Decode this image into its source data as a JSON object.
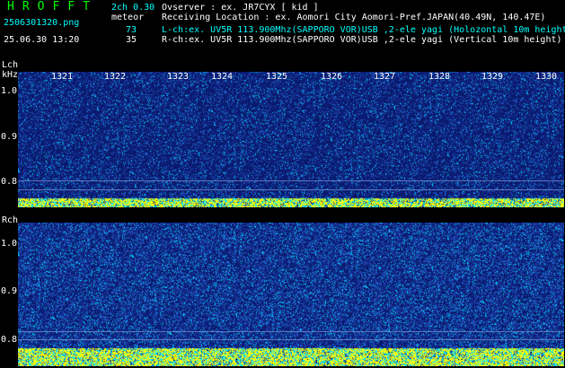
{
  "header": {
    "app_title": "HROFFT",
    "mode": "2ch 0.30",
    "meteor_label": "meteor",
    "filename": "2506301320.png",
    "datetime": "25.06.30 13:20",
    "count_l": "73",
    "count_r": "35",
    "observer": "Ovserver            : ex. JR7CYX [ kid ]",
    "receiving_location": "Receiving Location : ex. Aomori City Aomori-Pref.JAPAN(40.49N, 140.47E)",
    "lch_info": "L-ch:ex. UV5R 113.900Mhz(SAPPORO VOR)USB ,2-ele yagi (Holozontal 10m height)",
    "rch_info": "R-ch:ex. UV5R 113.900Mhz(SAPPORO VOR)USB ,2-ele yagi (Vertical 10m height)"
  },
  "left_channel": {
    "label": "Lch",
    "unit": "kHz",
    "yticks": [
      "1.0",
      "0.9",
      "0.8"
    ],
    "time_labels": [
      "1321",
      "1322",
      "1323",
      "1324",
      "1325",
      "1326",
      "1327",
      "1328",
      "1329",
      "1330"
    ]
  },
  "right_channel": {
    "label": "Rch",
    "yticks": [
      "1.0",
      "0.9",
      "0.8"
    ]
  },
  "colors": {
    "background": "#000000",
    "header_green": "#00ff00",
    "header_cyan": "#00ffff",
    "spectrum_dark": "#0a1a6e",
    "spectrum_cyan": "#00e5ff",
    "spectrum_yellow": "#ffff00"
  }
}
